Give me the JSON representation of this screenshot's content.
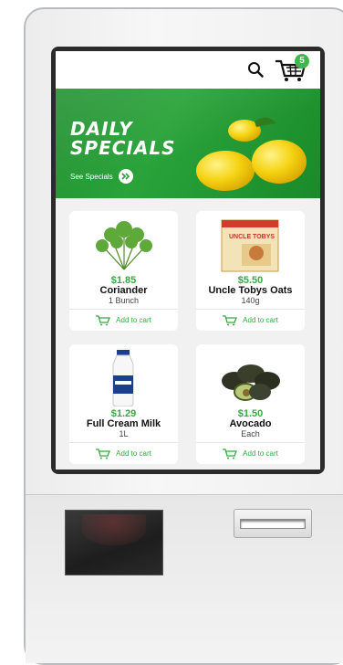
{
  "header": {
    "search_icon": "search-icon",
    "cart_icon": "cart-icon",
    "cart_count": "5"
  },
  "banner": {
    "title_line1": "DAILY",
    "title_line2": "SPECIALS",
    "link_label": "See Specials"
  },
  "products": [
    {
      "price": "$1.85",
      "name": "Coriander",
      "unit": "1 Bunch",
      "add_label": "Add to cart"
    },
    {
      "price": "$5.50",
      "name": "Uncle Tobys Oats",
      "unit": "140g",
      "add_label": "Add to cart",
      "package_text": "UNCLE TOBYS"
    },
    {
      "price": "$1.29",
      "name": "Full Cream Milk",
      "unit": "1L",
      "add_label": "Add to cart"
    },
    {
      "price": "$1.50",
      "name": "Avocado",
      "unit": "Each",
      "add_label": "Add to cart"
    }
  ],
  "colors": {
    "accent_green": "#35a942",
    "banner_green": "#2aa33a",
    "badge_green": "#3db84a"
  }
}
